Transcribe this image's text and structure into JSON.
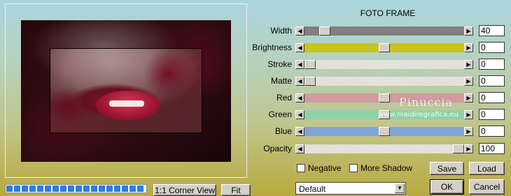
{
  "dialog": {
    "title": "FOTO FRAME"
  },
  "colors": {
    "width_track": "#808080",
    "brightness_track": "#c6c41e",
    "red_track": "#d19a9f",
    "green_track": "#8ed3a8",
    "blue_track": "#7fa3d7"
  },
  "sliders": [
    {
      "label": "Width",
      "value": "40",
      "level": 0.1,
      "track": "#808080"
    },
    {
      "label": "Brightness",
      "value": "0",
      "level": 0.5,
      "track": "#c6c41e"
    },
    {
      "label": "Stroke",
      "value": "0",
      "level": 0.0,
      "track": "pattern"
    },
    {
      "label": "Matte",
      "value": "0",
      "level": 0.0,
      "track": "pattern"
    },
    {
      "label": "Red",
      "value": "0",
      "level": 0.5,
      "track": "#d19a9f"
    },
    {
      "label": "Green",
      "value": "0",
      "level": 0.5,
      "track": "#8ed3a8"
    },
    {
      "label": "Blue",
      "value": "0",
      "level": 0.5,
      "track": "#7fa3d7"
    },
    {
      "label": "Opacity",
      "value": "100",
      "level": 1.0,
      "track": "pattern"
    }
  ],
  "options": {
    "negative": "Negative",
    "more_shadow": "More Shadow"
  },
  "buttons": {
    "save": "Save",
    "load": "Load",
    "ok": "OK",
    "cancel": "Cancel",
    "corner_view": "1:1 Corner View",
    "fit": "Fit"
  },
  "preset": {
    "selected": "Default"
  },
  "progress": {
    "value": 1.0
  },
  "watermark": {
    "name": "Pinuccia",
    "url": "www.maidiregrafica.eu"
  }
}
